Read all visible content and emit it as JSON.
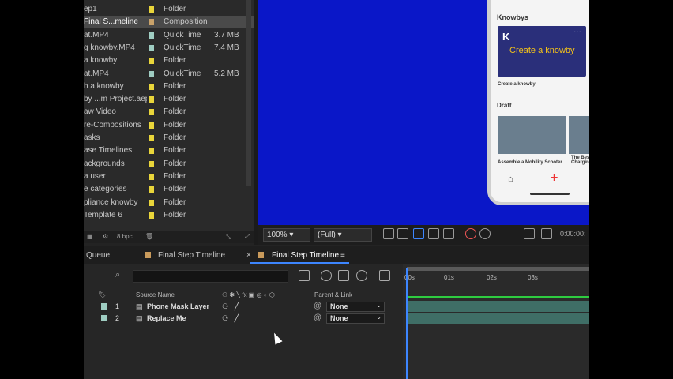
{
  "project_panel": {
    "items": [
      {
        "name": "ep1",
        "type": "Folder",
        "size": "",
        "color": "#e9d53a"
      },
      {
        "name": "Final S...meline",
        "type": "Composition",
        "size": "",
        "color": "#c9a26a",
        "selected": true
      },
      {
        "name": "at.MP4",
        "type": "QuickTime",
        "size": "3.7 MB",
        "color": "#9fcdc2"
      },
      {
        "name": "g knowby.MP4",
        "type": "QuickTime",
        "size": "7.4 MB",
        "color": "#9fcdc2"
      },
      {
        "name": "a knowby",
        "type": "Folder",
        "size": "",
        "color": "#e9d53a"
      },
      {
        "name": "at.MP4",
        "type": "QuickTime",
        "size": "5.2 MB",
        "color": "#9fcdc2"
      },
      {
        "name": "h a knowby",
        "type": "Folder",
        "size": "",
        "color": "#e9d53a"
      },
      {
        "name": "by ...m Project.aep",
        "type": "Folder",
        "size": "",
        "color": "#e9d53a"
      },
      {
        "name": "aw Video",
        "type": "Folder",
        "size": "",
        "color": "#e9d53a"
      },
      {
        "name": "re-Compositions",
        "type": "Folder",
        "size": "",
        "color": "#e9d53a"
      },
      {
        "name": "asks",
        "type": "Folder",
        "size": "",
        "color": "#e9d53a"
      },
      {
        "name": "ase Timelines",
        "type": "Folder",
        "size": "",
        "color": "#e9d53a"
      },
      {
        "name": "ackgrounds",
        "type": "Folder",
        "size": "",
        "color": "#e9d53a"
      },
      {
        "name": "a user",
        "type": "Folder",
        "size": "",
        "color": "#e9d53a"
      },
      {
        "name": "e categories",
        "type": "Folder",
        "size": "",
        "color": "#e9d53a"
      },
      {
        "name": "pliance knowby",
        "type": "Folder",
        "size": "",
        "color": "#e9d53a"
      },
      {
        "name": "Template 6",
        "type": "Folder",
        "size": "",
        "color": "#e9d53a"
      }
    ],
    "bpc_label": "8 bpc"
  },
  "viewer": {
    "background": "#0a17c8",
    "phone": {
      "section_title": "Knowbys",
      "card_cta": "Create a knowby",
      "card_caption": "Create a knowby",
      "draft_title": "Draft",
      "draft_caption": "Assemble a Mobility Scooter",
      "draft_caption2": "The Best Charging"
    },
    "zoom": "100%",
    "resolution": "(Full)",
    "timecode": "0:00:00:"
  },
  "timeline": {
    "tabs": [
      {
        "label": "Queue"
      },
      {
        "label": "Final Step Timeline"
      },
      {
        "label": "Final Step Timeline",
        "active": true
      }
    ],
    "columns": {
      "source_name": "Source Name",
      "parent_link": "Parent & Link"
    },
    "layers": [
      {
        "num": "1",
        "name": "Phone Mask Layer",
        "parent": "None"
      },
      {
        "num": "2",
        "name": "Replace Me",
        "parent": "None"
      }
    ],
    "ruler": [
      "00s",
      "01s",
      "02s",
      "03s"
    ]
  }
}
